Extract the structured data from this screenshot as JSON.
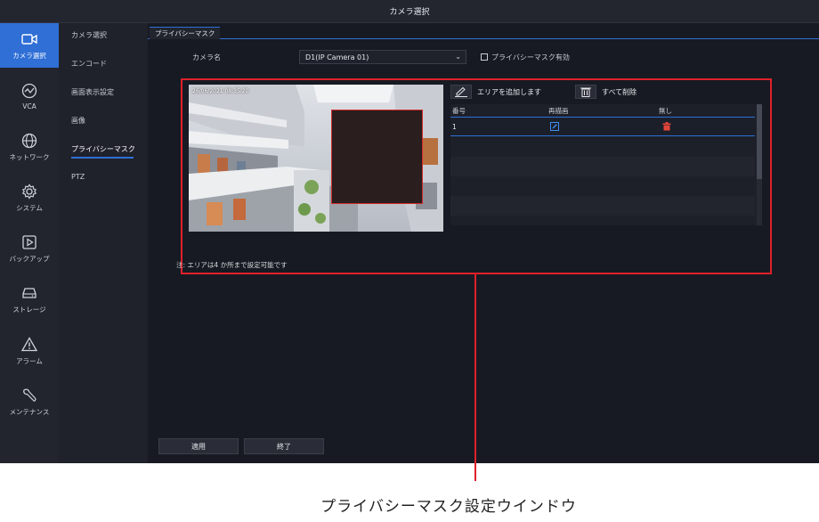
{
  "window": {
    "title": "カメラ選択"
  },
  "nav": {
    "items": [
      {
        "label": "カメラ選択",
        "icon": "camera-icon",
        "active": true
      },
      {
        "label": "VCA",
        "icon": "analytics-icon",
        "active": false
      },
      {
        "label": "ネットワーク",
        "icon": "globe-icon",
        "active": false
      },
      {
        "label": "システム",
        "icon": "gear-icon",
        "active": false
      },
      {
        "label": "バックアップ",
        "icon": "play-icon",
        "active": false
      },
      {
        "label": "ストレージ",
        "icon": "drive-icon",
        "active": false
      },
      {
        "label": "アラーム",
        "icon": "warning-icon",
        "active": false
      },
      {
        "label": "メンテナンス",
        "icon": "wrench-icon",
        "active": false
      }
    ]
  },
  "submenu": {
    "items": [
      {
        "label": "カメラ選択"
      },
      {
        "label": "エンコード"
      },
      {
        "label": "画面表示設定"
      },
      {
        "label": "画像"
      },
      {
        "label": "プライバシーマスク",
        "active": true
      },
      {
        "label": "PTZ"
      }
    ]
  },
  "tab": {
    "label": "プライバシーマスク"
  },
  "form": {
    "camera_label": "カメラ名",
    "camera_value": "D1(IP Camera 01)",
    "enable_label": "プライバシーマスク有効",
    "enable_checked": false
  },
  "preview": {
    "osd": "26/06/2021  08:35:20"
  },
  "toolbar": {
    "add_area": "エリアを追加します",
    "delete_all": "すべて削除"
  },
  "table": {
    "headers": [
      "番号",
      "再描画",
      "無し"
    ],
    "rows": [
      {
        "no": "1"
      }
    ]
  },
  "note": "注: エリアは4 か所まで設定可能です",
  "buttons": {
    "apply": "適用",
    "exit": "終了"
  },
  "caption": "プライバシーマスク設定ウインドウ",
  "colors": {
    "accent": "#2f6fd6",
    "highlight": "#e0202a",
    "background": "#171a22"
  }
}
